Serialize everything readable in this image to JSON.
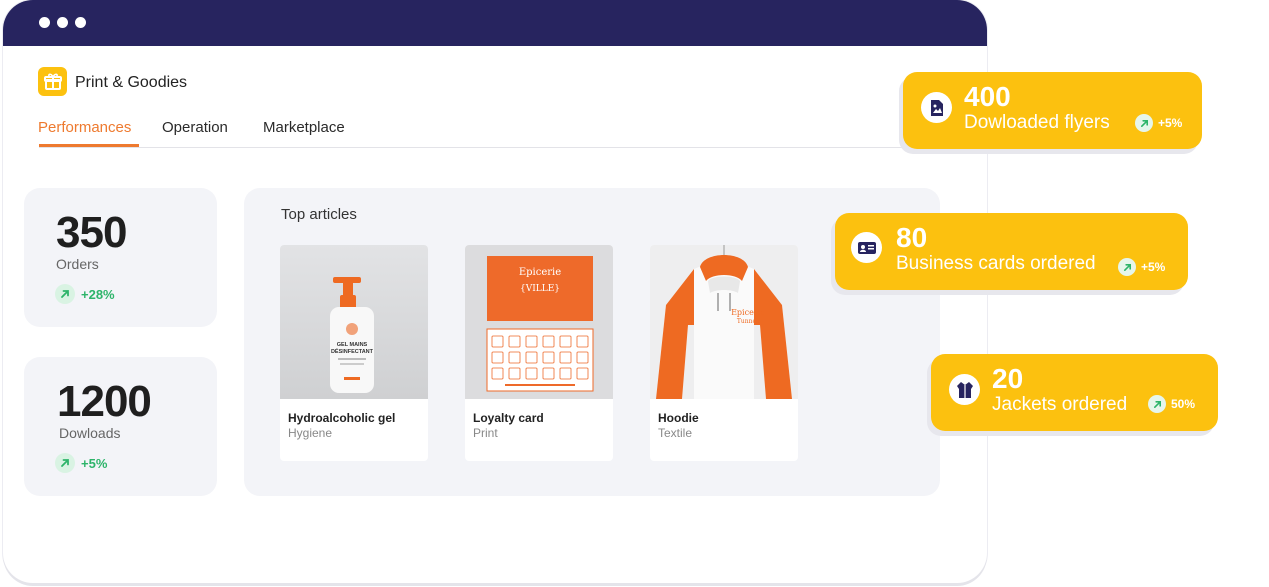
{
  "app": {
    "title": "Print & Goodies"
  },
  "tabs": [
    {
      "label": "Performances",
      "active": true
    },
    {
      "label": "Operation",
      "active": false
    },
    {
      "label": "Marketplace",
      "active": false
    }
  ],
  "stats": [
    {
      "value": "350",
      "label": "Orders",
      "trend": "+28%"
    },
    {
      "value": "1200",
      "label": "Dowloads",
      "trend": "+5%"
    }
  ],
  "top_articles": {
    "title": "Top articles",
    "items": [
      {
        "name": "Hydroalcoholic gel",
        "category": "Hygiene",
        "label_line1": "GEL MAINS",
        "label_line2": "DÉSINFECTANT"
      },
      {
        "name": "Loyalty card",
        "category": "Print",
        "card_line1": "Epicerie",
        "card_line2": "{VILLE}"
      },
      {
        "name": "Hoodie",
        "category": "Textile",
        "print_line1": "Epicerie",
        "print_line2": "Tunnes"
      }
    ]
  },
  "badges": [
    {
      "value": "400",
      "label": "Dowloaded flyers",
      "trend": "+5%",
      "icon": "flyer-icon"
    },
    {
      "value": "80",
      "label": "Business cards ordered",
      "trend": "+5%",
      "icon": "business-card-icon"
    },
    {
      "value": "20",
      "label": "Jackets ordered",
      "trend": "50%",
      "icon": "jacket-icon"
    }
  ],
  "colors": {
    "titlebar": "#27245f",
    "accent": "#ee7a2f",
    "badge": "#fcc10f",
    "positive": "#2db46a"
  }
}
